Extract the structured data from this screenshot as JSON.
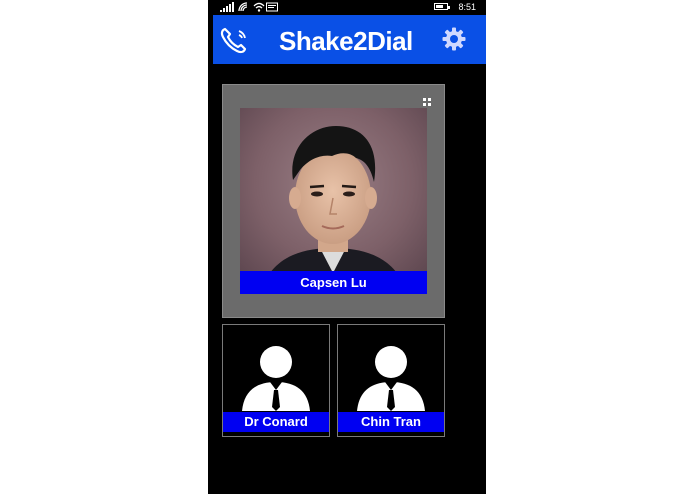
{
  "status_bar": {
    "time": "8:51"
  },
  "header": {
    "title": "Shake2Dial",
    "left_icon": "phone-ringing-icon",
    "right_icon": "gear-icon",
    "background": "#0a50e6"
  },
  "featured_contact": {
    "name": "Capsen Lu",
    "photo": "portrait"
  },
  "contacts": [
    {
      "name": "Dr Conard",
      "icon": "person-avatar-icon"
    },
    {
      "name": "Chin Tran",
      "icon": "person-avatar-icon"
    }
  ],
  "colors": {
    "name_bar": "#0000f2",
    "tile_bg": "#6b6b6b",
    "app_bg": "#000000"
  }
}
